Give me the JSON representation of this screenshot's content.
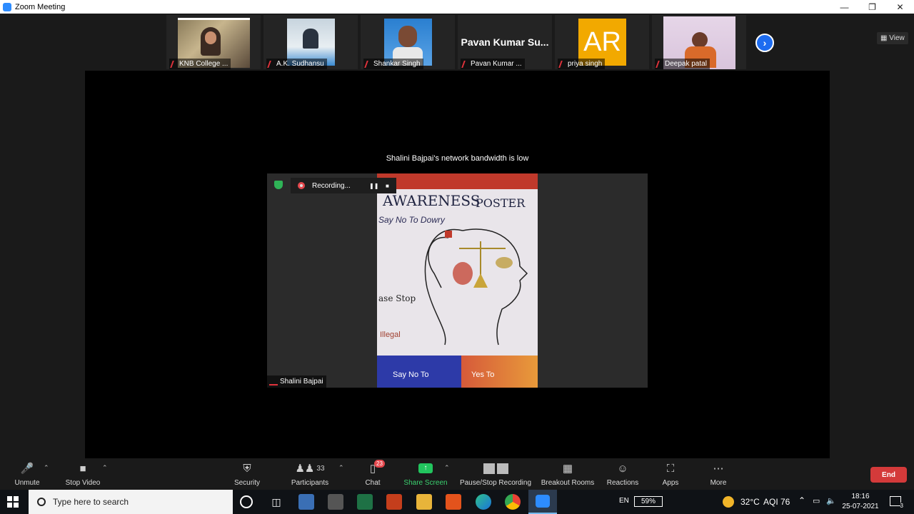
{
  "window": {
    "title": "Zoom Meeting"
  },
  "gallery": {
    "participants": [
      {
        "name": "KNB College ...",
        "muted": true
      },
      {
        "name": "A.K. Sudhansu",
        "muted": true
      },
      {
        "name": "Shankar Singh",
        "muted": true
      },
      {
        "name": "Pavan Kumar ...",
        "display_name": "Pavan Kumar Su...",
        "muted": true
      },
      {
        "name": "priya singh",
        "initials": "AR",
        "muted": true
      },
      {
        "name": "Deepak patal",
        "muted": true
      }
    ],
    "view_label": "View"
  },
  "stage": {
    "bandwidth_notice": "Shalini Bajpai's network bandwidth is low",
    "recording_label": "Recording...",
    "speaker_name": "Shalini Bajpai",
    "poster": {
      "title_left": "AWARENESS",
      "title_right": "POSTER",
      "line1": "Say No To Dowry",
      "line2": "ase Stop",
      "line3": "Illegal",
      "bottom_left": "Say No To",
      "bottom_right": "Yes To"
    }
  },
  "toolbar": {
    "unmute": "Unmute",
    "stop_video": "Stop Video",
    "security": "Security",
    "participants": "Participants",
    "participants_count": "33",
    "chat": "Chat",
    "chat_badge": "23",
    "share_screen": "Share Screen",
    "pause_stop_recording": "Pause/Stop Recording",
    "breakout_rooms": "Breakout Rooms",
    "reactions": "Reactions",
    "apps": "Apps",
    "more": "More",
    "end": "End"
  },
  "taskbar": {
    "search_placeholder": "Type here to search",
    "language": "EN",
    "battery": "59%",
    "battery_level": 0.59,
    "weather": "32°C",
    "aqi": "AQI 76",
    "time": "18:16",
    "date": "25-07-2021",
    "notifications": "3"
  },
  "colors": {
    "accent_blue": "#2d8cff",
    "end_red": "#d43a3a",
    "share_green": "#22c55e",
    "muted_red": "#e0323b"
  }
}
